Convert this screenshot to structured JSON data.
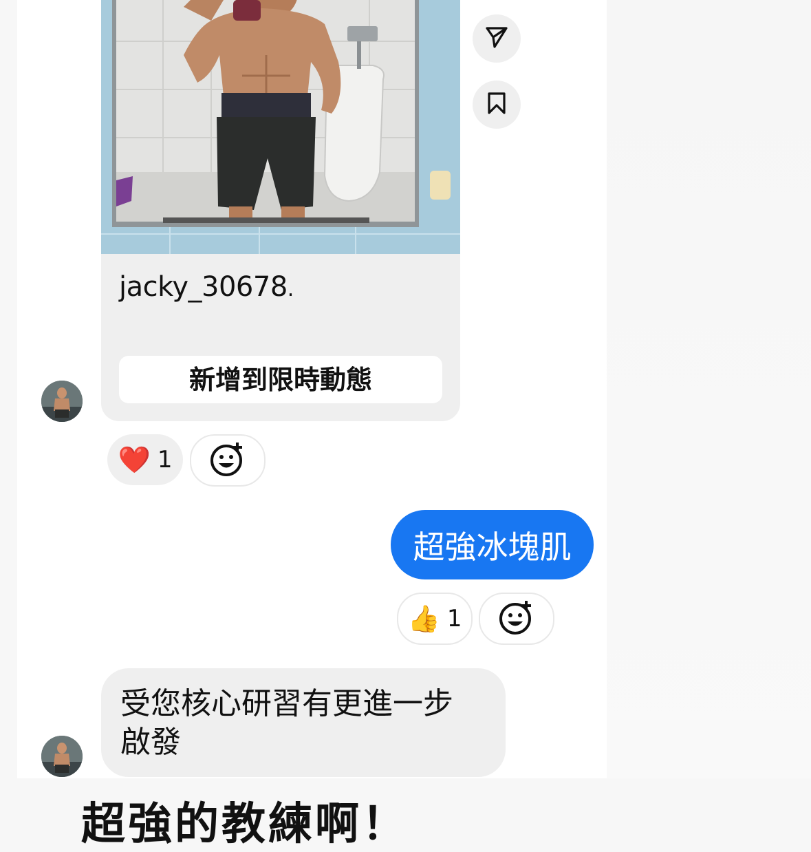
{
  "post": {
    "username": "jacky_30678",
    "username_suffix": ".",
    "add_to_story_label": "新增到限時動態"
  },
  "post_reaction": {
    "emoji": "❤️",
    "count": "1"
  },
  "outgoing_message": {
    "text": "超強冰塊肌",
    "reaction_emoji": "👍",
    "reaction_count": "1"
  },
  "incoming_message": {
    "line1": "受您核心研習有更進一步",
    "line2": "啟發"
  },
  "bottom_preview_text": "超強的教練啊！",
  "icons": {
    "share": "send-icon",
    "save": "bookmark-icon",
    "add_reaction": "add-emoji-icon"
  },
  "colors": {
    "outgoing_bubble": "#1877f2",
    "incoming_bubble": "#efefef"
  }
}
